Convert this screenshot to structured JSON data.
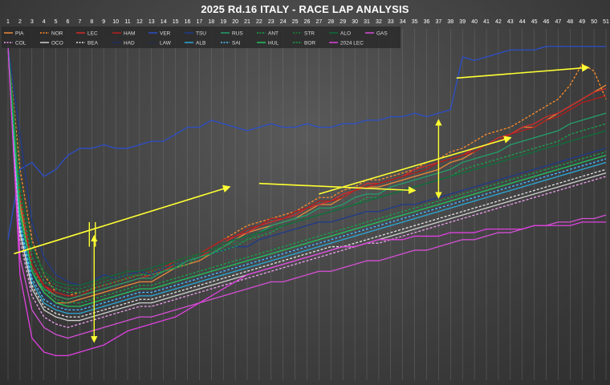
{
  "chart_data": {
    "type": "line",
    "title": "2025 Rd.16 ITALY - RACE LAP ANALYSIS",
    "xlabel": "",
    "ylabel": "",
    "x_ticks": [
      1,
      2,
      3,
      4,
      5,
      6,
      7,
      8,
      9,
      10,
      11,
      12,
      13,
      14,
      15,
      16,
      17,
      18,
      19,
      20,
      21,
      22,
      23,
      24,
      25,
      26,
      27,
      28,
      29,
      30,
      31,
      32,
      33,
      34,
      35,
      36,
      37,
      38,
      39,
      40,
      41,
      42,
      43,
      44,
      45,
      46,
      47,
      48,
      49,
      50,
      51
    ],
    "xlim": [
      1,
      51
    ],
    "grid": "vertical",
    "legend_placement": "top-left",
    "series": [
      {
        "name": "PIA",
        "color": "#e8893a",
        "dash": "solid",
        "values": [
          95,
          50,
          30,
          25,
          22,
          22,
          23,
          24,
          25,
          26,
          27,
          28,
          28,
          30,
          32,
          33,
          34,
          36,
          38,
          40,
          42,
          43,
          44,
          45,
          46,
          48,
          50,
          50,
          52,
          54,
          55,
          55,
          56,
          57,
          58,
          59,
          60,
          62,
          63,
          65,
          67,
          68,
          70,
          72,
          72,
          74,
          76,
          78,
          80,
          82,
          84
        ]
      },
      {
        "name": "NOR",
        "color": "#ff8c2a",
        "dash": "3,2",
        "values": [
          95,
          60,
          40,
          30,
          25,
          24,
          25,
          26,
          27,
          28,
          29,
          30,
          30,
          32,
          34,
          35,
          36,
          38,
          40,
          42,
          44,
          45,
          46,
          47,
          48,
          50,
          52,
          52,
          54,
          55,
          57,
          57,
          58,
          59,
          60,
          62,
          63,
          65,
          66,
          68,
          70,
          71,
          72,
          74,
          76,
          78,
          80,
          84,
          90,
          88,
          80
        ]
      },
      {
        "name": "LEC",
        "color": "#d62a2a",
        "dash": "solid",
        "values": [
          95,
          52,
          32,
          27,
          24,
          23,
          24,
          25,
          26,
          27,
          28,
          29,
          30,
          31,
          33,
          34,
          35,
          37,
          39,
          41,
          42,
          44,
          45,
          46,
          47,
          49,
          50,
          51,
          53,
          54,
          56,
          56,
          57,
          58,
          60,
          61,
          62,
          63,
          64,
          66,
          67,
          69,
          70,
          72,
          73,
          75,
          76,
          78,
          80,
          82,
          83
        ]
      },
      {
        "name": "HAM",
        "color": "#b31d1d",
        "dash": "solid",
        "values": [
          95,
          53,
          33,
          27,
          25,
          24,
          24,
          26,
          27,
          28,
          29,
          30,
          31,
          32,
          34,
          35,
          36,
          38,
          40,
          41,
          43,
          44,
          46,
          46,
          48,
          49,
          51,
          51,
          52,
          54,
          55,
          56,
          57,
          58,
          59,
          60,
          62,
          63,
          64,
          65,
          67,
          68,
          70,
          71,
          72,
          74,
          75,
          77,
          79,
          80,
          81
        ]
      },
      {
        "name": "VER",
        "color": "#2b4fc9",
        "dash": "solid",
        "values": [
          40,
          60,
          62,
          58,
          60,
          64,
          66,
          66,
          67,
          66,
          66,
          67,
          68,
          68,
          70,
          72,
          72,
          74,
          73,
          72,
          71,
          72,
          73,
          72,
          72,
          73,
          72,
          72,
          73,
          73,
          74,
          74,
          75,
          75,
          76,
          75,
          76,
          77,
          92,
          91,
          92,
          93,
          94,
          94,
          94,
          95,
          95,
          95,
          95,
          95,
          95
        ]
      },
      {
        "name": "TSU",
        "color": "#1e3a8c",
        "dash": "solid",
        "values": [
          95,
          70,
          45,
          35,
          30,
          28,
          27,
          28,
          30,
          29,
          30,
          31,
          30,
          32,
          33,
          34,
          35,
          36,
          37,
          38,
          38,
          40,
          41,
          42,
          43,
          44,
          45,
          45,
          46,
          47,
          48,
          48,
          49,
          50,
          50,
          51,
          52,
          53,
          54,
          55,
          56,
          57,
          58,
          59,
          60,
          61,
          62,
          63,
          64,
          65,
          66
        ]
      },
      {
        "name": "RUS",
        "color": "#22a06b",
        "dash": "solid",
        "values": [
          95,
          48,
          30,
          26,
          24,
          23,
          24,
          25,
          26,
          27,
          28,
          29,
          29,
          31,
          32,
          34,
          35,
          36,
          38,
          40,
          41,
          42,
          44,
          45,
          46,
          47,
          49,
          49,
          50,
          52,
          53,
          53,
          55,
          56,
          57,
          58,
          59,
          60,
          62,
          63,
          64,
          65,
          67,
          68,
          69,
          70,
          71,
          73,
          74,
          75,
          76
        ]
      },
      {
        "name": "ANT",
        "color": "#16a34a",
        "dash": "3,2",
        "values": [
          95,
          52,
          35,
          28,
          26,
          25,
          25,
          26,
          27,
          28,
          29,
          30,
          30,
          31,
          32,
          33,
          35,
          36,
          37,
          38,
          40,
          41,
          42,
          44,
          45,
          46,
          47,
          48,
          49,
          50,
          52,
          52,
          53,
          54,
          55,
          56,
          57,
          58,
          60,
          61,
          62,
          63,
          64,
          65,
          66,
          67,
          68,
          70,
          71,
          72,
          73
        ]
      },
      {
        "name": "STR",
        "color": "#15803d",
        "dash": "3,2",
        "values": [
          95,
          55,
          38,
          30,
          27,
          26,
          26,
          27,
          28,
          29,
          30,
          30,
          31,
          32,
          33,
          34,
          36,
          37,
          38,
          39,
          40,
          42,
          43,
          44,
          45,
          46,
          47,
          48,
          49,
          50,
          51,
          52,
          53,
          54,
          55,
          56,
          57,
          58,
          59,
          60,
          61,
          62,
          63,
          64,
          65,
          66,
          67,
          68,
          69,
          70,
          71
        ]
      },
      {
        "name": "ALO",
        "color": "#0f6b3a",
        "dash": "solid",
        "values": [
          95,
          56,
          38,
          31,
          28,
          27,
          27,
          28,
          29,
          30,
          31,
          31,
          32,
          33,
          34,
          35,
          36,
          37,
          39,
          40,
          41,
          42,
          43,
          44,
          45,
          46,
          47,
          48,
          49,
          50,
          51,
          52,
          53,
          54,
          55,
          56,
          57,
          58,
          59,
          60,
          61,
          62,
          63,
          64,
          65,
          66,
          67,
          68,
          69,
          70,
          71
        ]
      },
      {
        "name": "GAS",
        "color": "#d64fd6",
        "dash": "solid",
        "values": [
          95,
          35,
          20,
          15,
          13,
          12,
          13,
          14,
          15,
          16,
          17,
          18,
          18,
          19,
          20,
          21,
          22,
          23,
          24,
          25,
          26,
          27,
          28,
          28,
          29,
          30,
          31,
          31,
          32,
          33,
          34,
          34,
          35,
          36,
          37,
          37,
          38,
          39,
          40,
          40,
          41,
          42,
          42,
          43,
          44,
          44,
          45,
          45,
          46,
          46,
          47
        ]
      },
      {
        "name": "COL",
        "color": "#f0a0f0",
        "dash": "3,2",
        "values": [
          95,
          40,
          24,
          18,
          16,
          15,
          16,
          17,
          18,
          19,
          20,
          21,
          21,
          22,
          23,
          24,
          25,
          26,
          27,
          28,
          29,
          30,
          31,
          32,
          33,
          34,
          35,
          36,
          37,
          38,
          39,
          39,
          40,
          41,
          42,
          43,
          44,
          45,
          46,
          47,
          48,
          49,
          50,
          51,
          52,
          53,
          54,
          55,
          56,
          57,
          58
        ]
      },
      {
        "name": "OCO",
        "color": "#cfcfcf",
        "dash": "solid",
        "values": [
          95,
          42,
          26,
          20,
          18,
          17,
          17,
          18,
          19,
          20,
          21,
          22,
          22,
          23,
          24,
          25,
          26,
          27,
          28,
          29,
          30,
          31,
          32,
          33,
          34,
          35,
          36,
          37,
          38,
          38,
          39,
          40,
          41,
          42,
          43,
          44,
          45,
          46,
          47,
          48,
          49,
          50,
          51,
          52,
          53,
          54,
          55,
          56,
          57,
          58,
          59
        ]
      },
      {
        "name": "BEA",
        "color": "#e6e6e6",
        "dash": "3,2",
        "values": [
          95,
          43,
          27,
          21,
          19,
          18,
          18,
          19,
          20,
          21,
          22,
          23,
          23,
          24,
          25,
          26,
          27,
          28,
          29,
          30,
          31,
          32,
          33,
          34,
          35,
          36,
          37,
          38,
          38,
          39,
          40,
          41,
          42,
          43,
          44,
          45,
          46,
          47,
          48,
          49,
          50,
          51,
          52,
          53,
          54,
          55,
          56,
          57,
          58,
          59,
          60
        ]
      },
      {
        "name": "HAD",
        "color": "#1f2f66",
        "dash": "solid",
        "values": [
          95,
          45,
          30,
          24,
          21,
          20,
          20,
          21,
          22,
          23,
          24,
          25,
          25,
          26,
          27,
          28,
          29,
          30,
          31,
          32,
          33,
          34,
          35,
          36,
          37,
          38,
          39,
          40,
          41,
          42,
          43,
          44,
          45,
          46,
          47,
          48,
          49,
          50,
          51,
          52,
          53,
          54,
          55,
          56,
          57,
          58,
          59,
          60,
          61,
          62,
          63
        ]
      },
      {
        "name": "LAW",
        "color": "#1a2a5c",
        "dash": "3,2",
        "values": [
          95,
          46,
          31,
          25,
          22,
          21,
          21,
          22,
          23,
          24,
          25,
          26,
          26,
          27,
          28,
          29,
          30,
          31,
          32,
          33,
          34,
          35,
          36,
          37,
          38,
          39,
          40,
          41,
          42,
          43,
          44,
          45,
          46,
          47,
          48,
          49,
          50,
          51,
          52,
          53,
          54,
          55,
          56,
          57,
          58,
          59,
          60,
          61,
          62,
          63,
          64
        ]
      },
      {
        "name": "ALB",
        "color": "#2aa8d8",
        "dash": "solid",
        "values": [
          95,
          44,
          28,
          22,
          20,
          19,
          19,
          20,
          21,
          22,
          23,
          24,
          24,
          25,
          26,
          27,
          28,
          29,
          30,
          31,
          32,
          33,
          34,
          35,
          36,
          37,
          38,
          39,
          40,
          41,
          42,
          43,
          44,
          45,
          46,
          47,
          48,
          49,
          50,
          51,
          52,
          53,
          54,
          55,
          56,
          57,
          58,
          59,
          60,
          61,
          62
        ]
      },
      {
        "name": "SAI",
        "color": "#4fc3f7",
        "dash": "3,2",
        "values": [
          95,
          45,
          29,
          23,
          21,
          20,
          20,
          21,
          22,
          23,
          24,
          25,
          25,
          26,
          27,
          28,
          29,
          30,
          31,
          32,
          33,
          34,
          35,
          36,
          37,
          38,
          39,
          40,
          41,
          42,
          43,
          44,
          45,
          46,
          47,
          48,
          49,
          50,
          51,
          52,
          53,
          54,
          55,
          56,
          57,
          58,
          59,
          60,
          61,
          62,
          63
        ]
      },
      {
        "name": "HUL",
        "color": "#22c55e",
        "dash": "solid",
        "values": [
          95,
          47,
          31,
          25,
          22,
          21,
          21,
          22,
          23,
          24,
          25,
          26,
          26,
          27,
          28,
          29,
          30,
          31,
          32,
          33,
          34,
          35,
          36,
          37,
          38,
          39,
          40,
          41,
          42,
          43,
          44,
          45,
          46,
          47,
          48,
          49,
          50,
          51,
          52,
          53,
          54,
          55,
          56,
          57,
          58,
          59,
          60,
          61,
          62,
          63,
          64
        ]
      },
      {
        "name": "BOR",
        "color": "#16a34a",
        "dash": "3,2",
        "values": [
          95,
          48,
          32,
          26,
          23,
          22,
          22,
          23,
          24,
          25,
          26,
          27,
          27,
          28,
          29,
          30,
          31,
          32,
          33,
          34,
          35,
          36,
          37,
          38,
          39,
          40,
          41,
          42,
          43,
          44,
          45,
          46,
          47,
          48,
          49,
          50,
          51,
          52,
          53,
          54,
          55,
          56,
          57,
          58,
          59,
          60,
          61,
          62,
          63,
          64,
          65
        ]
      },
      {
        "name": "2024 LEC",
        "color": "#e040e0",
        "dash": "solid",
        "values": [
          95,
          30,
          12,
          8,
          7,
          7,
          8,
          9,
          10,
          12,
          14,
          15,
          16,
          17,
          18,
          20,
          22,
          24,
          26,
          28,
          30,
          31,
          32,
          33,
          34,
          35,
          36,
          37,
          38,
          38,
          39,
          40,
          40,
          40,
          41,
          41,
          41,
          42,
          42,
          42,
          43,
          43,
          43,
          43,
          44,
          44,
          44,
          44,
          45,
          45,
          45
        ]
      }
    ],
    "annotations": [
      {
        "type": "arrow",
        "from": [
          1.5,
          36
        ],
        "to": [
          19.5,
          55
        ]
      },
      {
        "type": "arrow",
        "from": [
          22,
          56
        ],
        "to": [
          35,
          54
        ]
      },
      {
        "type": "arrow",
        "from": [
          27,
          53
        ],
        "to": [
          43,
          69
        ]
      },
      {
        "type": "arrow",
        "from": [
          38.5,
          86
        ],
        "to": [
          49.5,
          89
        ]
      },
      {
        "type": "vline",
        "x": 7.8,
        "y1": 45,
        "y2": 38
      },
      {
        "type": "vline",
        "x": 8.3,
        "y1": 45,
        "y2": 38
      },
      {
        "type": "vline_arrow",
        "x": 8.2,
        "from": 41,
        "to": 11
      },
      {
        "type": "vline_arrow",
        "x": 37,
        "from": 74,
        "to": 52
      }
    ]
  }
}
